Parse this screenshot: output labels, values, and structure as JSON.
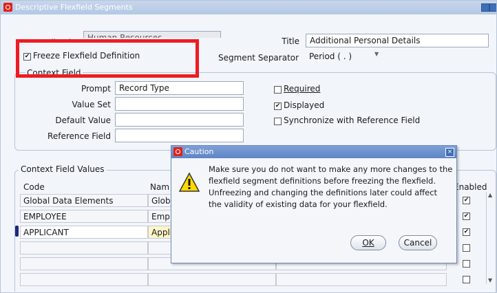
{
  "window": {
    "title": "Descriptive Flexfield Segments"
  },
  "header": {
    "application_label": "Application",
    "application_value": "Human Resources",
    "title_label": "Title",
    "title_value": "Additional Personal Details",
    "freeze_label": "Freeze Flexfield Definition",
    "freeze_checked": "✔",
    "separator_label": "Segment Separator",
    "separator_value": "Period ( . )"
  },
  "context_field": {
    "group_label": "Context Field",
    "prompt_label": "Prompt",
    "prompt_value": "Record Type",
    "value_set_label": "Value Set",
    "value_set_value": "",
    "default_value_label": "Default Value",
    "default_value_value": "",
    "reference_field_label": "Reference Field",
    "reference_field_value": "",
    "required_label": "Required",
    "required_mark": "",
    "displayed_label": "Displayed",
    "displayed_mark": "✔",
    "sync_label": "Synchronize with Reference Field",
    "sync_mark": ""
  },
  "context_values": {
    "group_label": "Context Field Values",
    "columns": {
      "code": "Code",
      "name": "Nam",
      "enabled": "Enabled"
    },
    "rows": [
      {
        "code": "Global Data Elements",
        "name": "Glob",
        "enabled": "✔"
      },
      {
        "code": "EMPLOYEE",
        "name": "Empl",
        "enabled": "✔"
      },
      {
        "code": "APPLICANT",
        "name": "Appli",
        "enabled": "✔"
      },
      {
        "code": "",
        "name": "",
        "enabled": ""
      },
      {
        "code": "",
        "name": "",
        "enabled": ""
      },
      {
        "code": "",
        "name": "",
        "enabled": ""
      }
    ]
  },
  "dialog": {
    "title": "Caution",
    "icon": "warning-icon",
    "message_lines": [
      "Make sure you do not want to make any more changes to the",
      "flexfield segment definitions before freezing the flexfield.",
      "Unfreezing and changing the definitions later could affect",
      "the validity of existing data for your flexfield."
    ],
    "ok_label": "OK",
    "cancel_label": "Cancel"
  },
  "colors": {
    "highlight_box": "#ee1c24",
    "title_bar": "#b4c8e4",
    "dialog_title": "#5d84c6"
  }
}
